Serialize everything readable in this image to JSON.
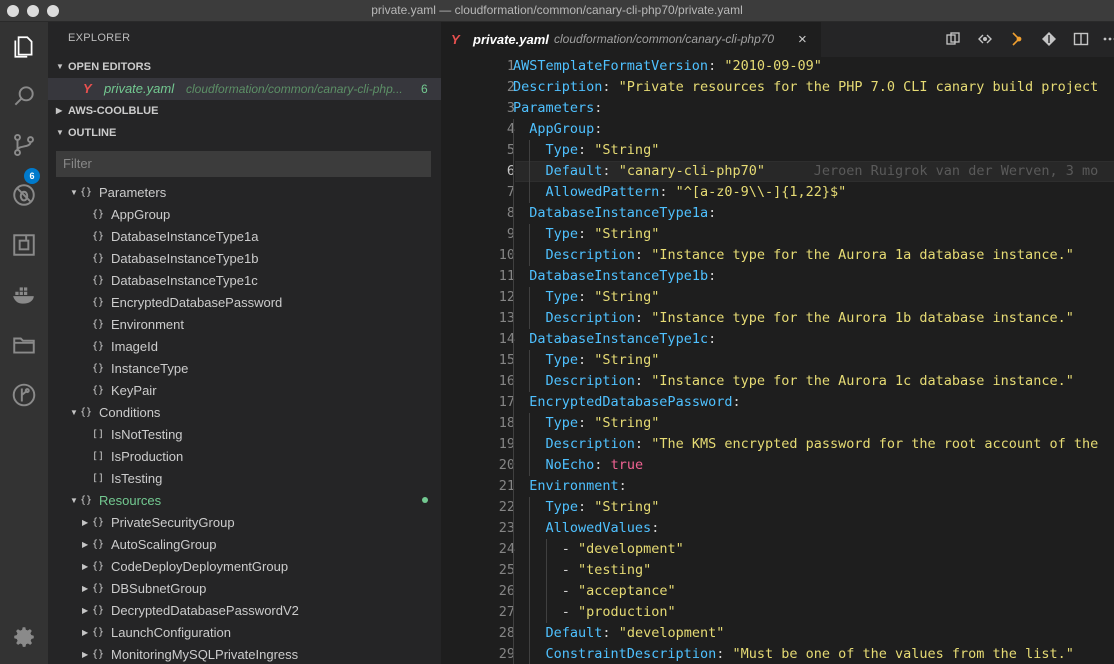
{
  "window": {
    "title": "private.yaml — cloudformation/common/canary-cli-php70/private.yaml"
  },
  "activity_bar": {
    "icons": [
      "files-icon",
      "search-icon",
      "source-control-icon",
      "debug-icon",
      "extensions-icon",
      "docker-icon",
      "folder-icon",
      "gitlens-icon",
      "gear-icon"
    ],
    "scm_badge": "6"
  },
  "explorer": {
    "title": "EXPLORER",
    "open_editors": {
      "label": "OPEN EDITORS",
      "items": [
        {
          "name": "private.yaml",
          "path": "cloudformation/common/canary-cli-php...",
          "problems": "6"
        }
      ]
    },
    "folder": {
      "label": "AWS-COOLBLUE"
    },
    "outline": {
      "label": "OUTLINE",
      "filter_placeholder": "Filter",
      "items": [
        {
          "label": "Parameters",
          "sym": "{}",
          "twisty": "▲"
        },
        {
          "label": "AppGroup",
          "sym": "{}",
          "twisty": ""
        },
        {
          "label": "DatabaseInstanceType1a",
          "sym": "{}",
          "twisty": ""
        },
        {
          "label": "DatabaseInstanceType1b",
          "sym": "{}",
          "twisty": ""
        },
        {
          "label": "DatabaseInstanceType1c",
          "sym": "{}",
          "twisty": ""
        },
        {
          "label": "EncryptedDatabasePassword",
          "sym": "{}",
          "twisty": ""
        },
        {
          "label": "Environment",
          "sym": "{}",
          "twisty": ""
        },
        {
          "label": "ImageId",
          "sym": "{}",
          "twisty": ""
        },
        {
          "label": "InstanceType",
          "sym": "{}",
          "twisty": ""
        },
        {
          "label": "KeyPair",
          "sym": "{}",
          "twisty": ""
        },
        {
          "label": "Conditions",
          "sym": "{}",
          "twisty": "▲"
        },
        {
          "label": "IsNotTesting",
          "sym": "[]",
          "twisty": ""
        },
        {
          "label": "IsProduction",
          "sym": "[]",
          "twisty": ""
        },
        {
          "label": "IsTesting",
          "sym": "[]",
          "twisty": ""
        },
        {
          "label": "Resources",
          "sym": "{}",
          "twisty": "▲"
        },
        {
          "label": "PrivateSecurityGroup",
          "sym": "{}",
          "twisty": "▶"
        },
        {
          "label": "AutoScalingGroup",
          "sym": "{}",
          "twisty": "▶"
        },
        {
          "label": "CodeDeployDeploymentGroup",
          "sym": "{}",
          "twisty": "▶"
        },
        {
          "label": "DBSubnetGroup",
          "sym": "{}",
          "twisty": "▶"
        },
        {
          "label": "DecryptedDatabasePasswordV2",
          "sym": "{}",
          "twisty": "▶"
        },
        {
          "label": "LaunchConfiguration",
          "sym": "{}",
          "twisty": "▶"
        },
        {
          "label": "MonitoringMySQLPrivateIngress",
          "sym": "{}",
          "twisty": "▶"
        }
      ]
    }
  },
  "editor": {
    "tab": {
      "filename": "private.yaml",
      "path": "cloudformation/common/canary-cli-php70",
      "close": "×"
    },
    "toolbar_icons": [
      "open-changes-icon",
      "compare-icon",
      "git-commit-icon",
      "git-branch-icon",
      "split-editor-icon",
      "more-icon"
    ],
    "current_line": "6",
    "blame": "Jeroen Ruigrok van der Werven, 3 mo",
    "lines": [
      {
        "n": "1",
        "indent": "",
        "key": "AWSTemplateFormatVersion",
        "sep": ": ",
        "val": "\"2010-09-09\""
      },
      {
        "n": "2",
        "indent": "",
        "key": "Description",
        "sep": ": ",
        "val": "\"Private resources for the PHP 7.0 CLI canary build project"
      },
      {
        "n": "3",
        "indent": "",
        "key": "Parameters",
        "sep": ":",
        "val": ""
      },
      {
        "n": "4",
        "indent": "  ",
        "key": "AppGroup",
        "sep": ":",
        "val": ""
      },
      {
        "n": "5",
        "indent": "    ",
        "key": "Type",
        "sep": ": ",
        "val": "\"String\""
      },
      {
        "n": "6",
        "indent": "    ",
        "key": "Default",
        "sep": ": ",
        "val": "\"canary-cli-php70\""
      },
      {
        "n": "7",
        "indent": "    ",
        "key": "AllowedPattern",
        "sep": ": ",
        "val": "\"^[a-z0-9\\\\-]{1,22}$\""
      },
      {
        "n": "8",
        "indent": "  ",
        "key": "DatabaseInstanceType1a",
        "sep": ":",
        "val": ""
      },
      {
        "n": "9",
        "indent": "    ",
        "key": "Type",
        "sep": ": ",
        "val": "\"String\""
      },
      {
        "n": "10",
        "indent": "    ",
        "key": "Description",
        "sep": ": ",
        "val": "\"Instance type for the Aurora 1a database instance.\""
      },
      {
        "n": "11",
        "indent": "  ",
        "key": "DatabaseInstanceType1b",
        "sep": ":",
        "val": ""
      },
      {
        "n": "12",
        "indent": "    ",
        "key": "Type",
        "sep": ": ",
        "val": "\"String\""
      },
      {
        "n": "13",
        "indent": "    ",
        "key": "Description",
        "sep": ": ",
        "val": "\"Instance type for the Aurora 1b database instance.\""
      },
      {
        "n": "14",
        "indent": "  ",
        "key": "DatabaseInstanceType1c",
        "sep": ":",
        "val": ""
      },
      {
        "n": "15",
        "indent": "    ",
        "key": "Type",
        "sep": ": ",
        "val": "\"String\""
      },
      {
        "n": "16",
        "indent": "    ",
        "key": "Description",
        "sep": ": ",
        "val": "\"Instance type for the Aurora 1c database instance.\""
      },
      {
        "n": "17",
        "indent": "  ",
        "key": "EncryptedDatabasePassword",
        "sep": ":",
        "val": ""
      },
      {
        "n": "18",
        "indent": "    ",
        "key": "Type",
        "sep": ": ",
        "val": "\"String\""
      },
      {
        "n": "19",
        "indent": "    ",
        "key": "Description",
        "sep": ": ",
        "val": "\"The KMS encrypted password for the root account of the"
      },
      {
        "n": "20",
        "indent": "    ",
        "key": "NoEcho",
        "sep": ": ",
        "val": "true",
        "bool": true
      },
      {
        "n": "21",
        "indent": "  ",
        "key": "Environment",
        "sep": ":",
        "val": ""
      },
      {
        "n": "22",
        "indent": "    ",
        "key": "Type",
        "sep": ": ",
        "val": "\"String\""
      },
      {
        "n": "23",
        "indent": "    ",
        "key": "AllowedValues",
        "sep": ":",
        "val": ""
      },
      {
        "n": "24",
        "indent": "      ",
        "key": "",
        "sep": "- ",
        "val": "\"development\""
      },
      {
        "n": "25",
        "indent": "      ",
        "key": "",
        "sep": "- ",
        "val": "\"testing\""
      },
      {
        "n": "26",
        "indent": "      ",
        "key": "",
        "sep": "- ",
        "val": "\"acceptance\""
      },
      {
        "n": "27",
        "indent": "      ",
        "key": "",
        "sep": "- ",
        "val": "\"production\""
      },
      {
        "n": "28",
        "indent": "    ",
        "key": "Default",
        "sep": ": ",
        "val": "\"development\""
      },
      {
        "n": "29",
        "indent": "    ",
        "key": "ConstraintDescription",
        "sep": ": ",
        "val": "\"Must be one of the values from the list.\""
      }
    ]
  },
  "colors": {
    "accent": "#007acc",
    "yaml_key": "#4fc1ff",
    "yaml_string": "#e6db74",
    "yaml_bool": "#f06292",
    "resources_label": "#73c991"
  }
}
